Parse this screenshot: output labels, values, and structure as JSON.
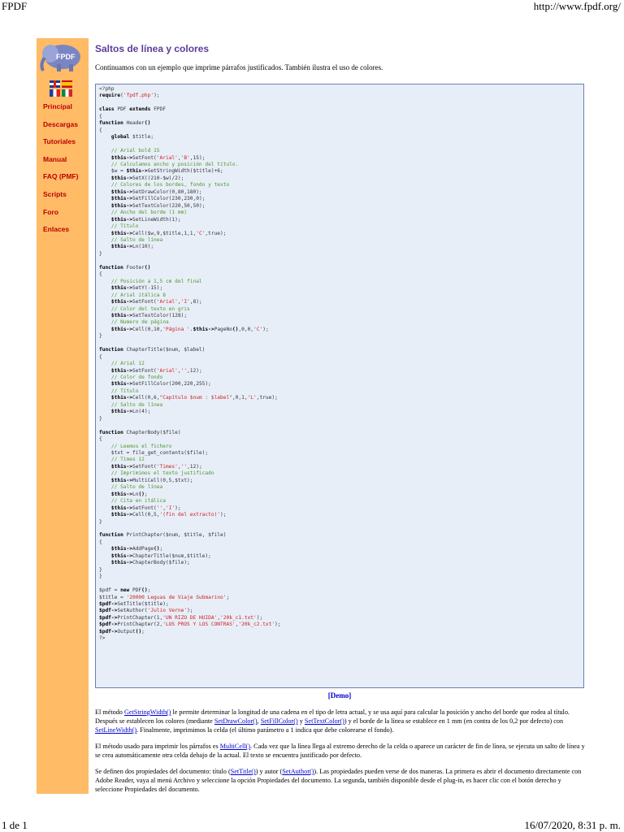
{
  "print_header": {
    "left": "FPDF",
    "right": "http://www.fpdf.org/"
  },
  "print_footer": {
    "left": "1 de 1",
    "right": "16/07/2020, 8:31 p. m."
  },
  "sidebar": {
    "logo_text": "FPDF",
    "nav": [
      "Principal",
      "Descargas",
      "Tutoriales",
      "Manual",
      "FAQ (PMF)",
      "Scripts",
      "Foro",
      "Enlaces"
    ],
    "languages": [
      "english",
      "espanol",
      "francais",
      "italiano"
    ]
  },
  "main": {
    "title": "Saltos de línea y colores",
    "intro": "Continuamos con un ejemplo que imprime párrafos justificados. También ilustra el uso de colores.",
    "demo_label": "[Demo]",
    "para1": {
      "t1": "El método ",
      "l1": "GetStringWidth()",
      "t2": " le permite determinar la longitud de una cadena en el tipo de letra actual, y se usa aquí para calcular la posición y ancho del borde que rodea al título. Después se establecen los colores (mediante ",
      "l2": "SetDrawColor()",
      "t3": ", ",
      "l3": "SetFillColor()",
      "t4": " y ",
      "l4": "SetTextColor()",
      "t5": ") y el borde de la línea se establece en 1 mm (en contra de los 0,2 por defecto) con ",
      "l5": "SetLineWidth()",
      "t6": ". Finalmente, imprimimos la celda (el último parámetro a 1 indica que debe colorearse el fondo)."
    },
    "para2": {
      "t1": "El método usado para imprimir los párrafos es ",
      "l1": "MultiCell()",
      "t2": ". Cada vez que la línea llega al extremo derecho de la celda o aparece un carácter de fin de línea, se ejecuta un salto de línea y se crea automáticamente otra celda debajo de la actual. El texto se encuentra justificado por defecto."
    },
    "para3": {
      "t1": "Se definen dos propiedades del documento: título (",
      "l1": "SetTitle()",
      "t2": ") y autor (",
      "l2": "SetAuthor()",
      "t3": "). Las propiedades pueden verse de dos maneras. La primera es abrir el documento directamente con Adobe Reader, vaya al menú Archivo y seleccione la opción Propiedades del documento. La segunda, también disponible desde el plug-in, es hacer clic con el botón derecho y seleccione Propiedades del documento."
    }
  },
  "code_lines": [
    [
      {
        "t": "<?php"
      }
    ],
    [
      {
        "t": "require",
        "c": "k"
      },
      {
        "t": "("
      },
      {
        "t": "'fpdf.php'",
        "c": "s"
      },
      {
        "t": ");"
      }
    ],
    [
      {
        "t": ""
      }
    ],
    [
      {
        "t": "class ",
        "c": "k"
      },
      {
        "t": "PDF "
      },
      {
        "t": "extends ",
        "c": "k"
      },
      {
        "t": "FPDF"
      }
    ],
    [
      {
        "t": "{"
      }
    ],
    [
      {
        "t": "function ",
        "c": "k"
      },
      {
        "t": "Header"
      },
      {
        "t": "()",
        "c": "k"
      }
    ],
    [
      {
        "t": "{"
      }
    ],
    [
      {
        "t": "    "
      },
      {
        "t": "global ",
        "c": "k"
      },
      {
        "t": "$title;"
      }
    ],
    [
      {
        "t": ""
      }
    ],
    [
      {
        "t": "    "
      },
      {
        "t": "// Arial bold 15",
        "c": "c"
      }
    ],
    [
      {
        "t": "    "
      },
      {
        "t": "$this->",
        "c": "k"
      },
      {
        "t": "SetFont("
      },
      {
        "t": "'Arial'",
        "c": "s"
      },
      {
        "t": ","
      },
      {
        "t": "'B'",
        "c": "s"
      },
      {
        "t": ",15);"
      }
    ],
    [
      {
        "t": "    "
      },
      {
        "t": "// Calculamos ancho y posición del título.",
        "c": "c"
      }
    ],
    [
      {
        "t": "    $w = "
      },
      {
        "t": "$this->",
        "c": "k"
      },
      {
        "t": "GetStringWidth($title)+6;"
      }
    ],
    [
      {
        "t": "    "
      },
      {
        "t": "$this->",
        "c": "k"
      },
      {
        "t": "SetX((210-$w)/2);"
      }
    ],
    [
      {
        "t": "    "
      },
      {
        "t": "// Colores de los bordes, fondo y texto",
        "c": "c"
      }
    ],
    [
      {
        "t": "    "
      },
      {
        "t": "$this->",
        "c": "k"
      },
      {
        "t": "SetDrawColor(0,80,180);"
      }
    ],
    [
      {
        "t": "    "
      },
      {
        "t": "$this->",
        "c": "k"
      },
      {
        "t": "SetFillColor(230,230,0);"
      }
    ],
    [
      {
        "t": "    "
      },
      {
        "t": "$this->",
        "c": "k"
      },
      {
        "t": "SetTextColor(220,50,50);"
      }
    ],
    [
      {
        "t": "    "
      },
      {
        "t": "// Ancho del borde (1 mm)",
        "c": "c"
      }
    ],
    [
      {
        "t": "    "
      },
      {
        "t": "$this->",
        "c": "k"
      },
      {
        "t": "SetLineWidth(1);"
      }
    ],
    [
      {
        "t": "    "
      },
      {
        "t": "// Título",
        "c": "c"
      }
    ],
    [
      {
        "t": "    "
      },
      {
        "t": "$this->",
        "c": "k"
      },
      {
        "t": "Cell($w,9,$title,1,1,"
      },
      {
        "t": "'C'",
        "c": "s"
      },
      {
        "t": ",true);"
      }
    ],
    [
      {
        "t": "    "
      },
      {
        "t": "// Salto de línea",
        "c": "c"
      }
    ],
    [
      {
        "t": "    "
      },
      {
        "t": "$this->",
        "c": "k"
      },
      {
        "t": "Ln(10);"
      }
    ],
    [
      {
        "t": "}"
      }
    ],
    [
      {
        "t": ""
      }
    ],
    [
      {
        "t": "function ",
        "c": "k"
      },
      {
        "t": "Footer"
      },
      {
        "t": "()",
        "c": "k"
      }
    ],
    [
      {
        "t": "{"
      }
    ],
    [
      {
        "t": "    "
      },
      {
        "t": "// Posición a 1,5 cm del final",
        "c": "c"
      }
    ],
    [
      {
        "t": "    "
      },
      {
        "t": "$this->",
        "c": "k"
      },
      {
        "t": "SetY(-15);"
      }
    ],
    [
      {
        "t": "    "
      },
      {
        "t": "// Arial itálica 8",
        "c": "c"
      }
    ],
    [
      {
        "t": "    "
      },
      {
        "t": "$this->",
        "c": "k"
      },
      {
        "t": "SetFont("
      },
      {
        "t": "'Arial'",
        "c": "s"
      },
      {
        "t": ","
      },
      {
        "t": "'I'",
        "c": "s"
      },
      {
        "t": ",8);"
      }
    ],
    [
      {
        "t": "    "
      },
      {
        "t": "// Color del texto en gris",
        "c": "c"
      }
    ],
    [
      {
        "t": "    "
      },
      {
        "t": "$this->",
        "c": "k"
      },
      {
        "t": "SetTextColor(128);"
      }
    ],
    [
      {
        "t": "    "
      },
      {
        "t": "// Numero de página",
        "c": "c"
      }
    ],
    [
      {
        "t": "    "
      },
      {
        "t": "$this->",
        "c": "k"
      },
      {
        "t": "Cell(0,10,"
      },
      {
        "t": "'Página '",
        "c": "s"
      },
      {
        "t": "."
      },
      {
        "t": "$this->",
        "c": "k"
      },
      {
        "t": "PageNo"
      },
      {
        "t": "()",
        "c": "k"
      },
      {
        "t": ",0,0,"
      },
      {
        "t": "'C'",
        "c": "s"
      },
      {
        "t": ");"
      }
    ],
    [
      {
        "t": "}"
      }
    ],
    [
      {
        "t": ""
      }
    ],
    [
      {
        "t": "function ",
        "c": "k"
      },
      {
        "t": "ChapterTitle($num, $label)"
      }
    ],
    [
      {
        "t": "{"
      }
    ],
    [
      {
        "t": "    "
      },
      {
        "t": "// Arial 12",
        "c": "c"
      }
    ],
    [
      {
        "t": "    "
      },
      {
        "t": "$this->",
        "c": "k"
      },
      {
        "t": "SetFont("
      },
      {
        "t": "'Arial'",
        "c": "s"
      },
      {
        "t": ","
      },
      {
        "t": "''",
        "c": "s"
      },
      {
        "t": ",12);"
      }
    ],
    [
      {
        "t": "    "
      },
      {
        "t": "// Color de fondo",
        "c": "c"
      }
    ],
    [
      {
        "t": "    "
      },
      {
        "t": "$this->",
        "c": "k"
      },
      {
        "t": "SetFillColor(200,220,255);"
      }
    ],
    [
      {
        "t": "    "
      },
      {
        "t": "// Título",
        "c": "c"
      }
    ],
    [
      {
        "t": "    "
      },
      {
        "t": "$this->",
        "c": "k"
      },
      {
        "t": "Cell(0,6,"
      },
      {
        "t": "\"Capítulo $num : $label\"",
        "c": "s"
      },
      {
        "t": ",0,1,"
      },
      {
        "t": "'L'",
        "c": "s"
      },
      {
        "t": ",true);"
      }
    ],
    [
      {
        "t": "    "
      },
      {
        "t": "// Salto de línea",
        "c": "c"
      }
    ],
    [
      {
        "t": "    "
      },
      {
        "t": "$this->",
        "c": "k"
      },
      {
        "t": "Ln(4);"
      }
    ],
    [
      {
        "t": "}"
      }
    ],
    [
      {
        "t": ""
      }
    ],
    [
      {
        "t": "function ",
        "c": "k"
      },
      {
        "t": "ChapterBody($file)"
      }
    ],
    [
      {
        "t": "{"
      }
    ],
    [
      {
        "t": "    "
      },
      {
        "t": "// Leemos el fichero",
        "c": "c"
      }
    ],
    [
      {
        "t": "    $txt = file_get_contents($file);"
      }
    ],
    [
      {
        "t": "    "
      },
      {
        "t": "// Times 12",
        "c": "c"
      }
    ],
    [
      {
        "t": "    "
      },
      {
        "t": "$this->",
        "c": "k"
      },
      {
        "t": "SetFont("
      },
      {
        "t": "'Times'",
        "c": "s"
      },
      {
        "t": ","
      },
      {
        "t": "''",
        "c": "s"
      },
      {
        "t": ",12);"
      }
    ],
    [
      {
        "t": "    "
      },
      {
        "t": "// Imprimimos el texto justificado",
        "c": "c"
      }
    ],
    [
      {
        "t": "    "
      },
      {
        "t": "$this->",
        "c": "k"
      },
      {
        "t": "MultiCell(0,5,$txt);"
      }
    ],
    [
      {
        "t": "    "
      },
      {
        "t": "// Salto de línea",
        "c": "c"
      }
    ],
    [
      {
        "t": "    "
      },
      {
        "t": "$this->",
        "c": "k"
      },
      {
        "t": "Ln"
      },
      {
        "t": "()",
        "c": "k"
      },
      {
        "t": ";"
      }
    ],
    [
      {
        "t": "    "
      },
      {
        "t": "// Cita en itálica",
        "c": "c"
      }
    ],
    [
      {
        "t": "    "
      },
      {
        "t": "$this->",
        "c": "k"
      },
      {
        "t": "SetFont("
      },
      {
        "t": "''",
        "c": "s"
      },
      {
        "t": ","
      },
      {
        "t": "'I'",
        "c": "s"
      },
      {
        "t": ");"
      }
    ],
    [
      {
        "t": "    "
      },
      {
        "t": "$this->",
        "c": "k"
      },
      {
        "t": "Cell(0,5,"
      },
      {
        "t": "'(fin del extracto)'",
        "c": "s"
      },
      {
        "t": ");"
      }
    ],
    [
      {
        "t": "}"
      }
    ],
    [
      {
        "t": ""
      }
    ],
    [
      {
        "t": "function ",
        "c": "k"
      },
      {
        "t": "PrintChapter($num, $title, $file)"
      }
    ],
    [
      {
        "t": "{"
      }
    ],
    [
      {
        "t": "    "
      },
      {
        "t": "$this->",
        "c": "k"
      },
      {
        "t": "AddPage"
      },
      {
        "t": "()",
        "c": "k"
      },
      {
        "t": ";"
      }
    ],
    [
      {
        "t": "    "
      },
      {
        "t": "$this->",
        "c": "k"
      },
      {
        "t": "ChapterTitle($num,$title);"
      }
    ],
    [
      {
        "t": "    "
      },
      {
        "t": "$this->",
        "c": "k"
      },
      {
        "t": "ChapterBody($file);"
      }
    ],
    [
      {
        "t": "}"
      }
    ],
    [
      {
        "t": "}"
      }
    ],
    [
      {
        "t": ""
      }
    ],
    [
      {
        "t": "$pdf = "
      },
      {
        "t": "new ",
        "c": "k"
      },
      {
        "t": "PDF"
      },
      {
        "t": "()",
        "c": "k"
      },
      {
        "t": ";"
      }
    ],
    [
      {
        "t": "$title = "
      },
      {
        "t": "'20000 Leguas de Viaje Submarino'",
        "c": "s"
      },
      {
        "t": ";"
      }
    ],
    [
      {
        "t": "$pdf->",
        "c": "k"
      },
      {
        "t": "SetTitle($title);"
      }
    ],
    [
      {
        "t": "$pdf->",
        "c": "k"
      },
      {
        "t": "SetAuthor("
      },
      {
        "t": "'Julio Verne'",
        "c": "s"
      },
      {
        "t": ");"
      }
    ],
    [
      {
        "t": "$pdf->",
        "c": "k"
      },
      {
        "t": "PrintChapter(1,"
      },
      {
        "t": "'UN RIZO DE HUIDA'",
        "c": "s"
      },
      {
        "t": ","
      },
      {
        "t": "'20k_c1.txt'",
        "c": "s"
      },
      {
        "t": ");"
      }
    ],
    [
      {
        "t": "$pdf->",
        "c": "k"
      },
      {
        "t": "PrintChapter(2,"
      },
      {
        "t": "'LOS PROS Y LOS CONTRAS'",
        "c": "s"
      },
      {
        "t": ","
      },
      {
        "t": "'20k_c2.txt'",
        "c": "s"
      },
      {
        "t": ");"
      }
    ],
    [
      {
        "t": "$pdf->",
        "c": "k"
      },
      {
        "t": "Output"
      },
      {
        "t": "()",
        "c": "k"
      },
      {
        "t": ";"
      }
    ],
    [
      {
        "t": "?>"
      }
    ]
  ]
}
